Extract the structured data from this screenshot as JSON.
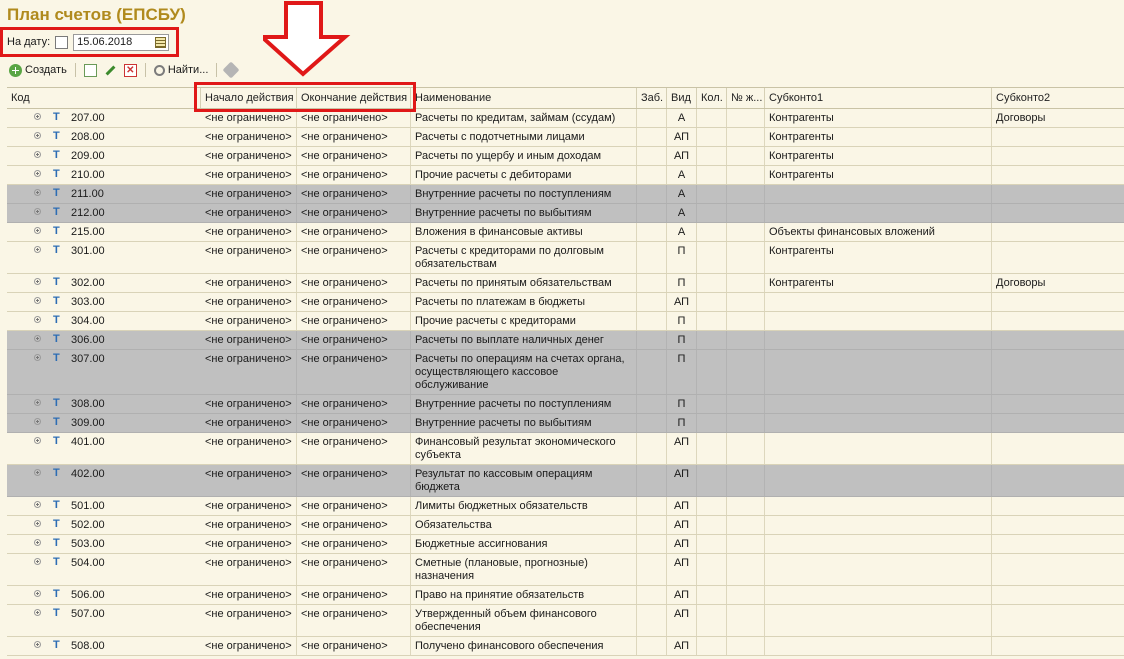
{
  "window": {
    "title": "План счетов (ЕПСБУ)"
  },
  "filter": {
    "date_label": "На дату:",
    "date_value": "15.06.2018"
  },
  "toolbar": {
    "create_label": "Создать",
    "find_label": "Найти..."
  },
  "columns": [
    "Код",
    "Начало действия",
    "Окончание действия",
    "Наименование",
    "Заб.",
    "Вид",
    "Кол.",
    "№ ж...",
    "Субконто1",
    "Субконто2"
  ],
  "rows": [
    {
      "code": "207.00",
      "start": "<не ограничено>",
      "end": "<не ограничено>",
      "name": "Расчеты по кредитам, займам (ссудам)",
      "vid": "А",
      "sub1": "Контрагенты",
      "sub2": "Договоры",
      "gray": false,
      "tall": false
    },
    {
      "code": "208.00",
      "start": "<не ограничено>",
      "end": "<не ограничено>",
      "name": "Расчеты с подотчетными лицами",
      "vid": "АП",
      "sub1": "Контрагенты",
      "sub2": "",
      "gray": false,
      "tall": false
    },
    {
      "code": "209.00",
      "start": "<не ограничено>",
      "end": "<не ограничено>",
      "name": "Расчеты по ущербу и иным доходам",
      "vid": "АП",
      "sub1": "Контрагенты",
      "sub2": "",
      "gray": false,
      "tall": false
    },
    {
      "code": "210.00",
      "start": "<не ограничено>",
      "end": "<не ограничено>",
      "name": "Прочие расчеты с дебиторами",
      "vid": "А",
      "sub1": "Контрагенты",
      "sub2": "",
      "gray": false,
      "tall": false
    },
    {
      "code": "211.00",
      "start": "<не ограничено>",
      "end": "<не ограничено>",
      "name": "Внутренние расчеты по поступлениям",
      "vid": "А",
      "sub1": "",
      "sub2": "",
      "gray": true,
      "tall": false
    },
    {
      "code": "212.00",
      "start": "<не ограничено>",
      "end": "<не ограничено>",
      "name": "Внутренние расчеты по выбытиям",
      "vid": "А",
      "sub1": "",
      "sub2": "",
      "gray": true,
      "tall": false
    },
    {
      "code": "215.00",
      "start": "<не ограничено>",
      "end": "<не ограничено>",
      "name": "Вложения в финансовые активы",
      "vid": "А",
      "sub1": "Объекты финансовых вложений",
      "sub2": "",
      "gray": false,
      "tall": false
    },
    {
      "code": "301.00",
      "start": "<не ограничено>",
      "end": "<не ограничено>",
      "name": "Расчеты с кредиторами по долговым обязательствам",
      "vid": "П",
      "sub1": "Контрагенты",
      "sub2": "",
      "gray": false,
      "tall": true
    },
    {
      "code": "302.00",
      "start": "<не ограничено>",
      "end": "<не ограничено>",
      "name": "Расчеты по принятым обязательствам",
      "vid": "П",
      "sub1": "Контрагенты",
      "sub2": "Договоры",
      "gray": false,
      "tall": false
    },
    {
      "code": "303.00",
      "start": "<не ограничено>",
      "end": "<не ограничено>",
      "name": "Расчеты по платежам в бюджеты",
      "vid": "АП",
      "sub1": "",
      "sub2": "",
      "gray": false,
      "tall": false
    },
    {
      "code": "304.00",
      "start": "<не ограничено>",
      "end": "<не ограничено>",
      "name": "Прочие расчеты с кредиторами",
      "vid": "П",
      "sub1": "",
      "sub2": "",
      "gray": false,
      "tall": false
    },
    {
      "code": "306.00",
      "start": "<не ограничено>",
      "end": "<не ограничено>",
      "name": "Расчеты по выплате наличных денег",
      "vid": "П",
      "sub1": "",
      "sub2": "",
      "gray": true,
      "tall": false
    },
    {
      "code": "307.00",
      "start": "<не ограничено>",
      "end": "<не ограничено>",
      "name": "Расчеты по операциям на счетах органа, осуществляющего кассовое обслуживание",
      "vid": "П",
      "sub1": "",
      "sub2": "",
      "gray": true,
      "tall": "x3"
    },
    {
      "code": "308.00",
      "start": "<не ограничено>",
      "end": "<не ограничено>",
      "name": "Внутренние расчеты по поступлениям",
      "vid": "П",
      "sub1": "",
      "sub2": "",
      "gray": true,
      "tall": false
    },
    {
      "code": "309.00",
      "start": "<не ограничено>",
      "end": "<не ограничено>",
      "name": "Внутренние расчеты по выбытиям",
      "vid": "П",
      "sub1": "",
      "sub2": "",
      "gray": true,
      "tall": false
    },
    {
      "code": "401.00",
      "start": "<не ограничено>",
      "end": "<не ограничено>",
      "name": "Финансовый результат экономического субъекта",
      "vid": "АП",
      "sub1": "",
      "sub2": "",
      "gray": false,
      "tall": true
    },
    {
      "code": "402.00",
      "start": "<не ограничено>",
      "end": "<не ограничено>",
      "name": "Результат по кассовым операциям бюджета",
      "vid": "АП",
      "sub1": "",
      "sub2": "",
      "gray": true,
      "tall": true
    },
    {
      "code": "501.00",
      "start": "<не ограничено>",
      "end": "<не ограничено>",
      "name": "Лимиты бюджетных обязательств",
      "vid": "АП",
      "sub1": "",
      "sub2": "",
      "gray": false,
      "tall": false
    },
    {
      "code": "502.00",
      "start": "<не ограничено>",
      "end": "<не ограничено>",
      "name": "Обязательства",
      "vid": "АП",
      "sub1": "",
      "sub2": "",
      "gray": false,
      "tall": false
    },
    {
      "code": "503.00",
      "start": "<не ограничено>",
      "end": "<не ограничено>",
      "name": "Бюджетные ассигнования",
      "vid": "АП",
      "sub1": "",
      "sub2": "",
      "gray": false,
      "tall": false
    },
    {
      "code": "504.00",
      "start": "<не ограничено>",
      "end": "<не ограничено>",
      "name": "Сметные (плановые, прогнозные) назначения",
      "vid": "АП",
      "sub1": "",
      "sub2": "",
      "gray": false,
      "tall": true
    },
    {
      "code": "506.00",
      "start": "<не ограничено>",
      "end": "<не ограничено>",
      "name": "Право на принятие обязательств",
      "vid": "АП",
      "sub1": "",
      "sub2": "",
      "gray": false,
      "tall": false
    },
    {
      "code": "507.00",
      "start": "<не ограничено>",
      "end": "<не ограничено>",
      "name": "Утвержденный объем финансового обеспечения",
      "vid": "АП",
      "sub1": "",
      "sub2": "",
      "gray": false,
      "tall": true
    },
    {
      "code": "508.00",
      "start": "<не ограничено>",
      "end": "<не ограничено>",
      "name": "Получено финансового обеспечения",
      "vid": "АП",
      "sub1": "",
      "sub2": "",
      "gray": false,
      "tall": false
    }
  ],
  "icons": {
    "create": "plus-circle-icon",
    "copy": "copy-icon",
    "edit": "pencil-icon",
    "delete": "delete-icon",
    "find": "magnifier-icon",
    "plug": "plug-icon",
    "calendar": "calendar-icon",
    "tree": "expand-icon",
    "type": "t-icon"
  },
  "colors": {
    "background": "#faf6e6",
    "title": "#b08a1d",
    "highlight": "#e01818",
    "gray_row": "#c0c0c0",
    "type_icon": "#2d6db4"
  }
}
